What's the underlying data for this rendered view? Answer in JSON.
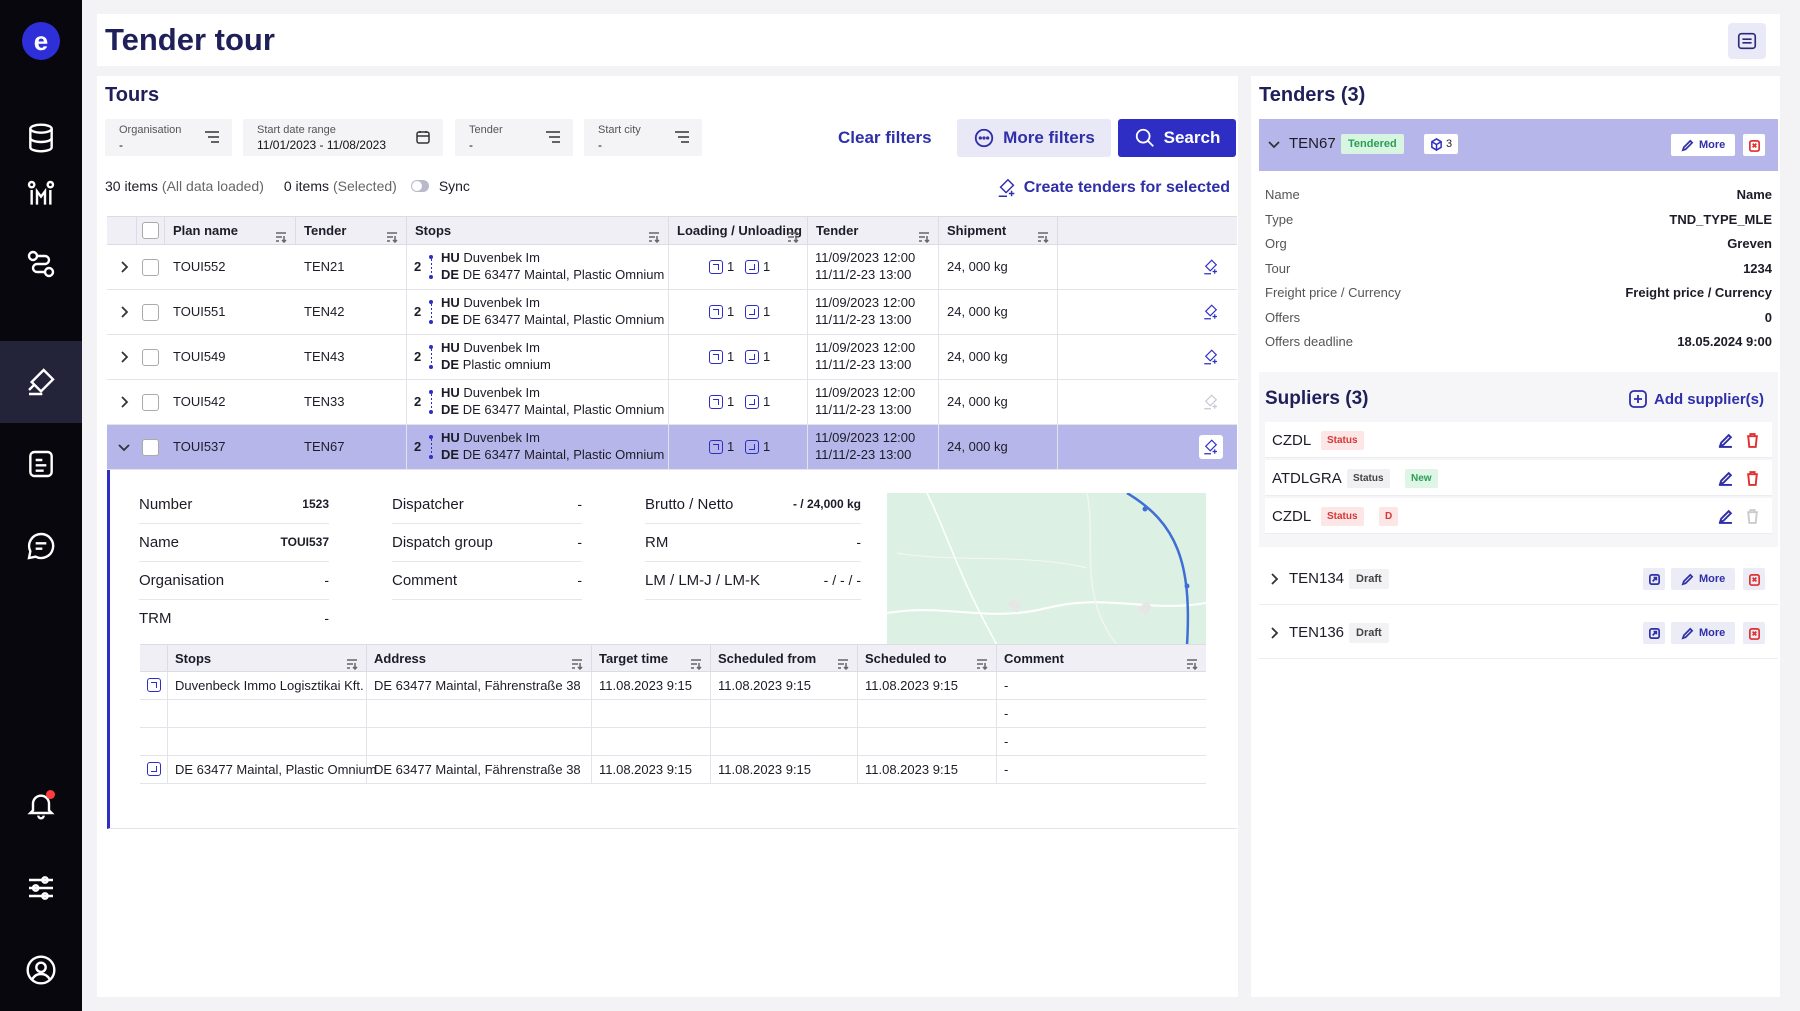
{
  "header": {
    "title": "Tender tour"
  },
  "nav": {
    "logo_letter": "e",
    "items": [
      "database-icon",
      "tours-icon",
      "route-icon",
      "tender-icon",
      "document-icon",
      "chat-icon",
      "bell-icon",
      "sliders-icon",
      "profile-icon"
    ],
    "active": "tender-icon"
  },
  "tours": {
    "title": "Tours",
    "filters": [
      {
        "label": "Organisation",
        "value": "-"
      },
      {
        "label": "Start date range",
        "value": "11/01/2023 - 11/08/2023"
      },
      {
        "label": "Tender",
        "value": "-"
      },
      {
        "label": "Start city",
        "value": "-"
      }
    ],
    "clear_filters": "Clear filters",
    "more_filters": "More filters",
    "search": "Search",
    "items_count": "30 items",
    "items_note": "(All data loaded)",
    "selected_count": "0 items",
    "selected_note": "(Selected)",
    "sync": "Sync",
    "create_tenders": "Create tenders for selected",
    "columns": [
      "Plan name",
      "Tender",
      "Stops",
      "Loading / Unloading",
      "Tender",
      "Shipment"
    ],
    "rows": [
      {
        "plan": "TOUI552",
        "tender": "TEN21",
        "stops": "2",
        "stop1_bold": "HU",
        "stop1": "Duvenbek Im",
        "stop2_bold": "DE",
        "stop2": "DE 63477 Maintal, Plastic Omnium",
        "load": "1",
        "unload": "1",
        "t1": "11/09/2023 12:00",
        "t2": "11/11/2-23 13:00",
        "shipment": "24, 000 kg"
      },
      {
        "plan": "TOUI551",
        "tender": "TEN42",
        "stops": "2",
        "stop1_bold": "HU",
        "stop1": "Duvenbek Im",
        "stop2_bold": "DE",
        "stop2": "DE 63477 Maintal, Plastic Omnium",
        "load": "1",
        "unload": "1",
        "t1": "11/09/2023 12:00",
        "t2": "11/11/2-23 13:00",
        "shipment": "24, 000 kg"
      },
      {
        "plan": "TOUI549",
        "tender": "TEN43",
        "stops": "2",
        "stop1_bold": "HU",
        "stop1": "Duvenbek Im",
        "stop2_bold": "DE",
        "stop2": "Plastic omnium",
        "load": "1",
        "unload": "1",
        "t1": "11/09/2023 12:00",
        "t2": "11/11/2-23 13:00",
        "shipment": "24, 000 kg"
      },
      {
        "plan": "TOUI542",
        "tender": "TEN33",
        "stops": "2",
        "stop1_bold": "HU",
        "stop1": "Duvenbek Im",
        "stop2_bold": "DE",
        "stop2": "DE 63477 Maintal, Plastic Omnium",
        "load": "1",
        "unload": "1",
        "t1": "11/09/2023 12:00",
        "t2": "11/11/2-23 13:00",
        "shipment": "24, 000 kg"
      },
      {
        "plan": "TOUI537",
        "tender": "TEN67",
        "stops": "2",
        "stop1_bold": "HU",
        "stop1": "Duvenbek Im",
        "stop2_bold": "DE",
        "stop2": "DE 63477 Maintal, Plastic Omnium",
        "load": "1",
        "unload": "1",
        "t1": "11/09/2023 12:00",
        "t2": "11/11/2-23 13:00",
        "shipment": "24, 000 kg"
      }
    ],
    "expanded": {
      "details_col1": [
        {
          "k": "Number",
          "v": "1523"
        },
        {
          "k": "Name",
          "v": "TOUI537"
        },
        {
          "k": "Organisation",
          "v": "-"
        },
        {
          "k": "TRM",
          "v": "-"
        }
      ],
      "details_col2": [
        {
          "k": "Dispatcher",
          "v": "-"
        },
        {
          "k": "Dispatch group",
          "v": "-"
        },
        {
          "k": "Comment",
          "v": "-"
        }
      ],
      "details_col3": [
        {
          "k": "Brutto / Netto",
          "v": "- / 24,000 kg"
        },
        {
          "k": "RM",
          "v": "-"
        },
        {
          "k": "LM / LM-J / LM-K",
          "v": "- / - / -"
        }
      ],
      "stops_columns": [
        "Stops",
        "Address",
        "Target time",
        "Scheduled from",
        "Scheduled to",
        "Comment"
      ],
      "stops_rows": [
        {
          "type": "load",
          "stop": "Duvenbeck Immo Logisztikai Kft.",
          "address": "DE 63477 Maintal, Fährenstraße 38",
          "target": "11.08.2023 9:15",
          "from": "11.08.2023 9:15",
          "to": "11.08.2023 9:15",
          "comment": "-"
        },
        {
          "type": "",
          "stop": "",
          "address": "",
          "target": "",
          "from": "",
          "to": "",
          "comment": "-"
        },
        {
          "type": "",
          "stop": "",
          "address": "",
          "target": "",
          "from": "",
          "to": "",
          "comment": "-"
        },
        {
          "type": "unload",
          "stop": "DE 63477 Maintal, Plastic Omnium",
          "address": "DE 63477 Maintal, Fährenstraße 38",
          "target": "11.08.2023 9:15",
          "from": "11.08.2023 9:15",
          "to": "11.08.2023 9:15",
          "comment": "-"
        }
      ]
    }
  },
  "tenders": {
    "title": "Tenders (3)",
    "open": {
      "name": "TEN67",
      "status": "Tendered",
      "count": "3",
      "more": "More",
      "props": [
        {
          "k": "Name",
          "v": "Name"
        },
        {
          "k": "Type",
          "v": "TND_TYPE_MLE"
        },
        {
          "k": "Org",
          "v": "Greven"
        },
        {
          "k": "Tour",
          "v": "1234"
        },
        {
          "k": "Freight price / Currency",
          "v": "Freight price / Currency"
        },
        {
          "k": "Offers",
          "v": "0"
        },
        {
          "k": "Offers deadline",
          "v": "18.05.2024 9:00"
        }
      ],
      "suppliers_title": "Supliers (3)",
      "add_supplier": "Add supplier(s)",
      "suppliers": [
        {
          "name": "CZDL",
          "status": "Status",
          "status_style": "red",
          "extra": ""
        },
        {
          "name": "ATDLGRA",
          "status": "Status",
          "status_style": "gray",
          "extra": "New"
        },
        {
          "name": "CZDL",
          "status": "Status",
          "status_style": "red",
          "extra": "D"
        }
      ]
    },
    "others": [
      {
        "name": "TEN134",
        "status": "Draft",
        "more": "More"
      },
      {
        "name": "TEN136",
        "status": "Draft",
        "more": "More"
      }
    ]
  },
  "colors": {
    "accent": "#2e2ec4",
    "selected_row": "#b7b6ea",
    "nav_bg": "#07070d"
  }
}
